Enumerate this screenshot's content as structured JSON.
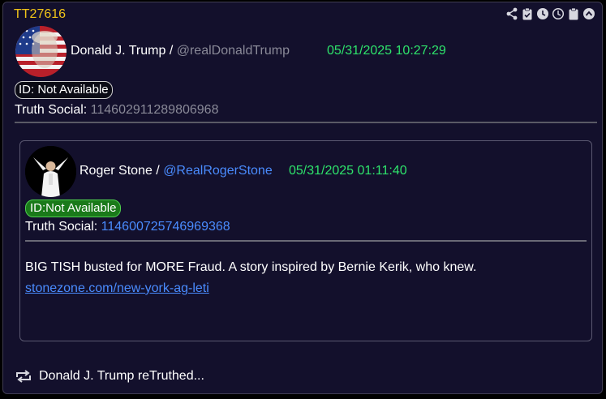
{
  "post": {
    "id": "TT27616",
    "author_name": "Donald J. Trump",
    "author_sep": " / ",
    "author_handle": "@realDonaldTrump",
    "timestamp": "05/31/2025 10:27:29",
    "id_badge": "ID: Not Available",
    "truth_social_label": "Truth Social:",
    "truth_social_id": "114602911289806968"
  },
  "toolbar": {
    "icons": [
      "share-icon",
      "clipboard-check-icon",
      "clock-filled-icon",
      "clock-outline-icon",
      "clipboard-icon",
      "scroll-up-icon"
    ]
  },
  "quoted": {
    "author_name": "Roger Stone",
    "author_sep": " / ",
    "author_handle": "@RealRogerStone",
    "timestamp": "05/31/2025 01:11:40",
    "id_badge": "ID:Not Available",
    "truth_social_label": "Truth Social:",
    "truth_social_id": "114600725746969368",
    "text": "BIG TISH busted for MORE  Fraud. A story inspired by Bernie Kerik, who knew.",
    "link": "stonezone.com/new-york-ag-leti"
  },
  "footer": {
    "retruth_text": "Donald J. Trump  reTruthed..."
  },
  "colors": {
    "accent_id": "#f0c419",
    "timestamp": "#2ee36b",
    "link": "#4a8cff",
    "background": "#13102c"
  }
}
